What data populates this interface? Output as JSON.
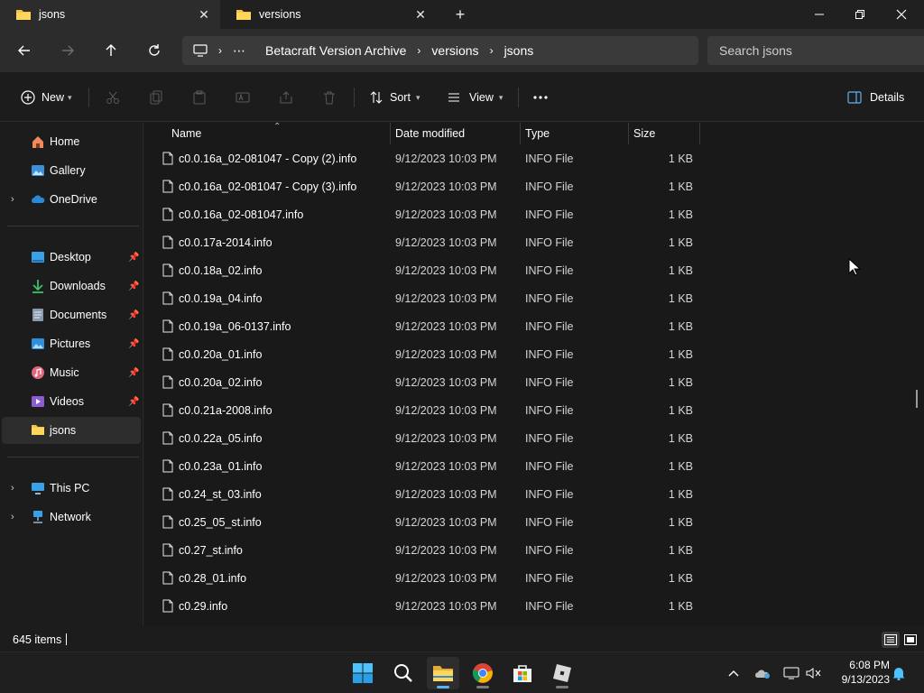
{
  "tabs": [
    {
      "label": "jsons",
      "active": true
    },
    {
      "label": "versions",
      "active": false
    }
  ],
  "address": {
    "crumbs": [
      "Betacraft Version Archive",
      "versions",
      "jsons"
    ]
  },
  "search": {
    "placeholder": "Search jsons"
  },
  "commands": {
    "new_label": "New",
    "sort_label": "Sort",
    "view_label": "View",
    "details_label": "Details"
  },
  "sidebar": {
    "quick": [
      {
        "label": "Home",
        "icon": "home-icon"
      },
      {
        "label": "Gallery",
        "icon": "gallery-icon"
      },
      {
        "label": "OneDrive",
        "icon": "onedrive-icon"
      }
    ],
    "pinned": [
      {
        "label": "Desktop",
        "icon": "desktop-icon"
      },
      {
        "label": "Downloads",
        "icon": "downloads-icon"
      },
      {
        "label": "Documents",
        "icon": "documents-icon"
      },
      {
        "label": "Pictures",
        "icon": "pictures-icon"
      },
      {
        "label": "Music",
        "icon": "music-icon"
      },
      {
        "label": "Videos",
        "icon": "videos-icon"
      },
      {
        "label": "jsons",
        "icon": "folder-icon"
      }
    ],
    "devices": [
      {
        "label": "This PC",
        "icon": "this-pc-icon"
      },
      {
        "label": "Network",
        "icon": "network-icon"
      }
    ]
  },
  "columns": {
    "name": "Name",
    "date": "Date modified",
    "type": "Type",
    "size": "Size"
  },
  "files": [
    {
      "name": "c0.0.16a_02-081047 - Copy (2).info",
      "date": "9/12/2023 10:03 PM",
      "type": "INFO File",
      "size": "1 KB"
    },
    {
      "name": "c0.0.16a_02-081047 - Copy (3).info",
      "date": "9/12/2023 10:03 PM",
      "type": "INFO File",
      "size": "1 KB"
    },
    {
      "name": "c0.0.16a_02-081047.info",
      "date": "9/12/2023 10:03 PM",
      "type": "INFO File",
      "size": "1 KB"
    },
    {
      "name": "c0.0.17a-2014.info",
      "date": "9/12/2023 10:03 PM",
      "type": "INFO File",
      "size": "1 KB"
    },
    {
      "name": "c0.0.18a_02.info",
      "date": "9/12/2023 10:03 PM",
      "type": "INFO File",
      "size": "1 KB"
    },
    {
      "name": "c0.0.19a_04.info",
      "date": "9/12/2023 10:03 PM",
      "type": "INFO File",
      "size": "1 KB"
    },
    {
      "name": "c0.0.19a_06-0137.info",
      "date": "9/12/2023 10:03 PM",
      "type": "INFO File",
      "size": "1 KB"
    },
    {
      "name": "c0.0.20a_01.info",
      "date": "9/12/2023 10:03 PM",
      "type": "INFO File",
      "size": "1 KB"
    },
    {
      "name": "c0.0.20a_02.info",
      "date": "9/12/2023 10:03 PM",
      "type": "INFO File",
      "size": "1 KB"
    },
    {
      "name": "c0.0.21a-2008.info",
      "date": "9/12/2023 10:03 PM",
      "type": "INFO File",
      "size": "1 KB"
    },
    {
      "name": "c0.0.22a_05.info",
      "date": "9/12/2023 10:03 PM",
      "type": "INFO File",
      "size": "1 KB"
    },
    {
      "name": "c0.0.23a_01.info",
      "date": "9/12/2023 10:03 PM",
      "type": "INFO File",
      "size": "1 KB"
    },
    {
      "name": "c0.24_st_03.info",
      "date": "9/12/2023 10:03 PM",
      "type": "INFO File",
      "size": "1 KB"
    },
    {
      "name": "c0.25_05_st.info",
      "date": "9/12/2023 10:03 PM",
      "type": "INFO File",
      "size": "1 KB"
    },
    {
      "name": "c0.27_st.info",
      "date": "9/12/2023 10:03 PM",
      "type": "INFO File",
      "size": "1 KB"
    },
    {
      "name": "c0.28_01.info",
      "date": "9/12/2023 10:03 PM",
      "type": "INFO File",
      "size": "1 KB"
    },
    {
      "name": "c0.29.info",
      "date": "9/12/2023 10:03 PM",
      "type": "INFO File",
      "size": "1 KB"
    }
  ],
  "status": {
    "item_count": "645 items"
  },
  "taskbar": {
    "apps": [
      "start-icon",
      "search-icon",
      "file-explorer-icon",
      "chrome-icon",
      "microsoft-store-icon",
      "roblox-icon"
    ],
    "time": "6:08 PM",
    "date": "9/13/2023"
  },
  "colors": {
    "accent": "#5fb2f2",
    "folder": "#f4c542",
    "background": "#1c1c1c"
  }
}
